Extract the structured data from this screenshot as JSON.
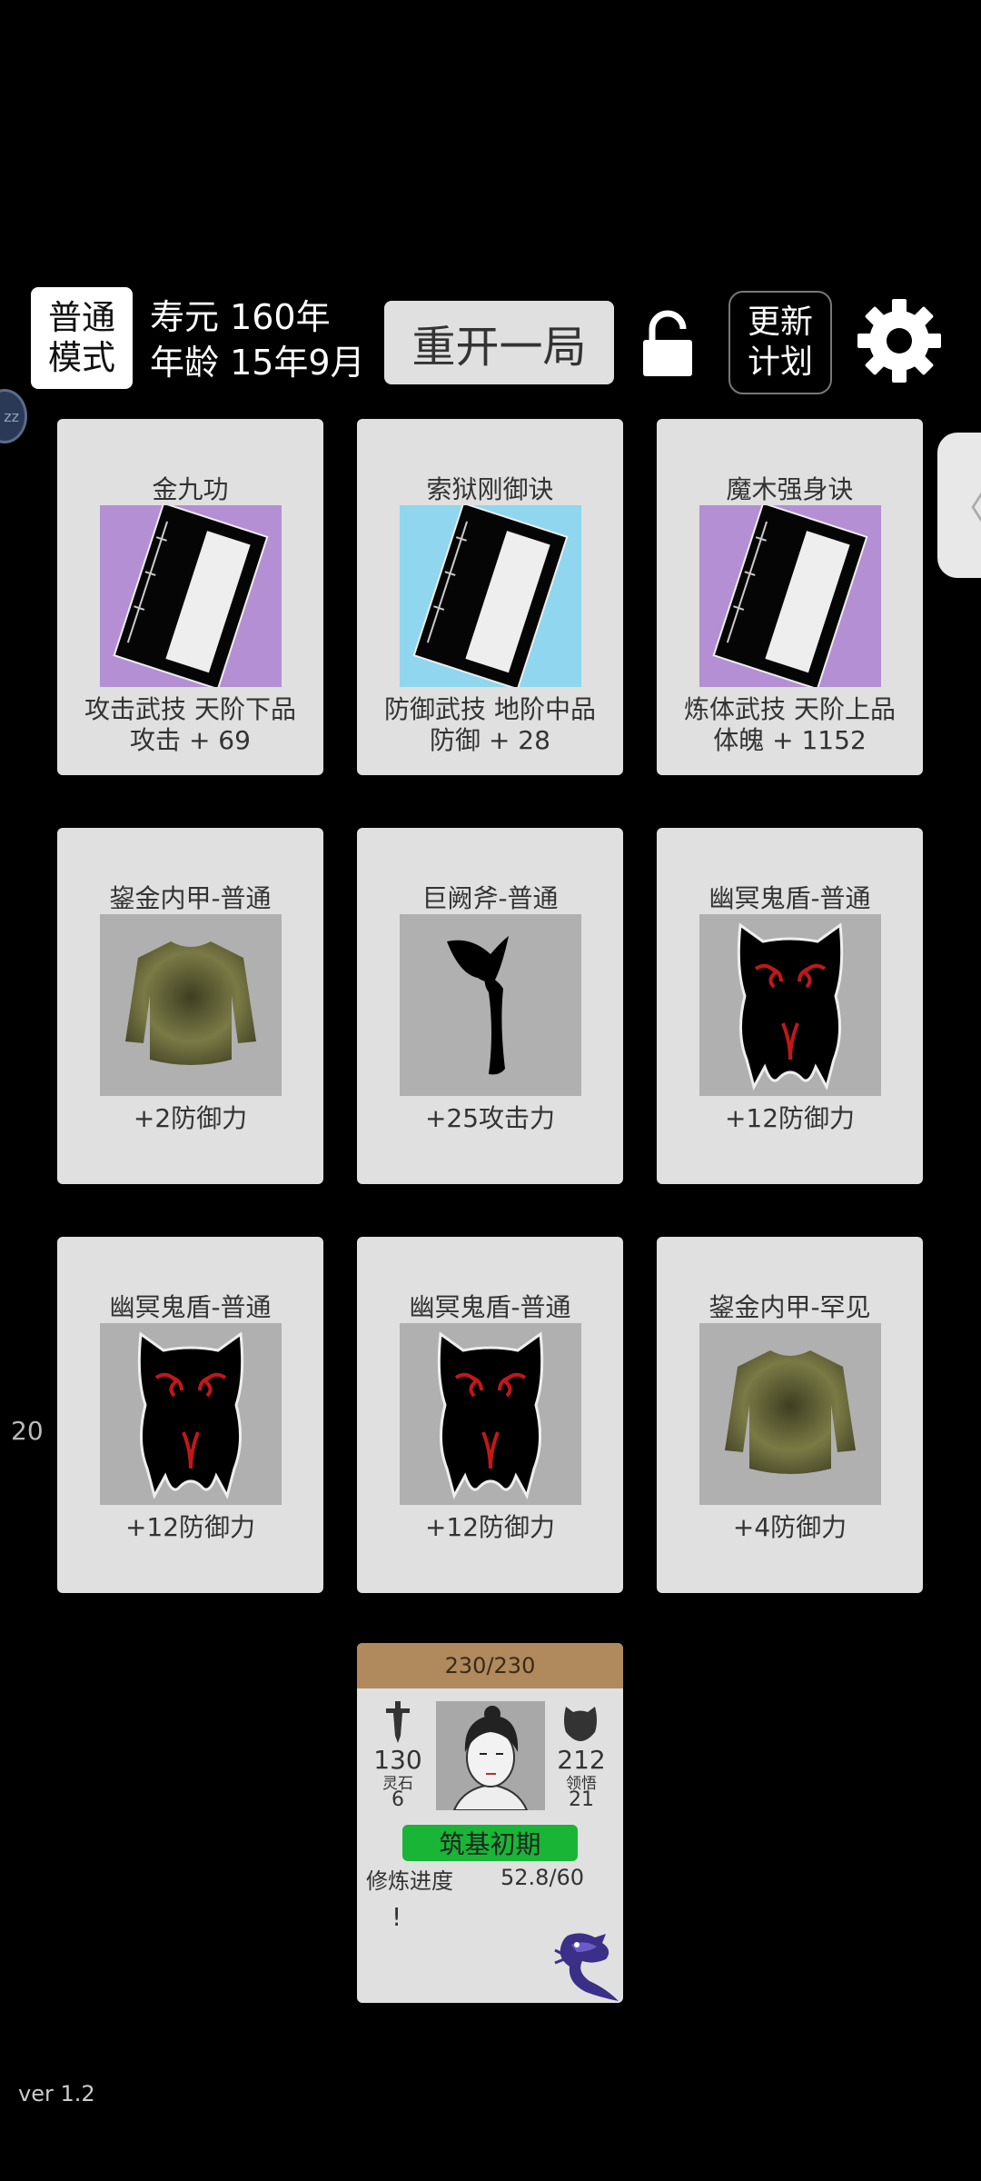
{
  "header": {
    "mode_line1": "普通",
    "mode_line2": "模式",
    "lifespan": "寿元 160年",
    "age": "年龄 15年9月",
    "restart_label": "重开一局",
    "update_line1": "更新",
    "update_line2": "计划"
  },
  "side": {
    "badge": "zz",
    "tab_arrow": "〈",
    "number": "20"
  },
  "skills": [
    {
      "name": "金九功",
      "line1": "攻击武技  天阶下品",
      "line2": "攻击 + 69",
      "bg": "#b48fd3"
    },
    {
      "name": "索狱刚御诀",
      "line1": "防御武技  地阶中品",
      "line2": "防御 + 28",
      "bg": "#8fd6ee"
    },
    {
      "name": "魔木强身诀",
      "line1": "炼体武技  天阶上品",
      "line2": "体魄 + 1152",
      "bg": "#b48fd3"
    }
  ],
  "equipment": [
    {
      "name": "鋆金内甲-普通",
      "effect": "+2防御力",
      "icon": "shirt-icon"
    },
    {
      "name": "巨阙斧-普通",
      "effect": "+25攻击力",
      "icon": "axe-icon"
    },
    {
      "name": "幽冥鬼盾-普通",
      "effect": "+12防御力",
      "icon": "shield-icon"
    },
    {
      "name": "幽冥鬼盾-普通",
      "effect": "+12防御力",
      "icon": "shield-icon"
    },
    {
      "name": "幽冥鬼盾-普通",
      "effect": "+12防御力",
      "icon": "shield-icon"
    },
    {
      "name": "鋆金内甲-罕见",
      "effect": "+4防御力",
      "icon": "shirt-icon"
    }
  ],
  "character": {
    "hp": "230/230",
    "attack": "130",
    "defense": "212",
    "stone_label": "灵石",
    "stone_value": "6",
    "insight_label": "领悟",
    "insight_value": "21",
    "realm": "筑基初期",
    "progress_label": "修炼进度",
    "progress_value": "52.8/60",
    "alert": "!"
  },
  "footer": {
    "version": "ver 1.2"
  }
}
